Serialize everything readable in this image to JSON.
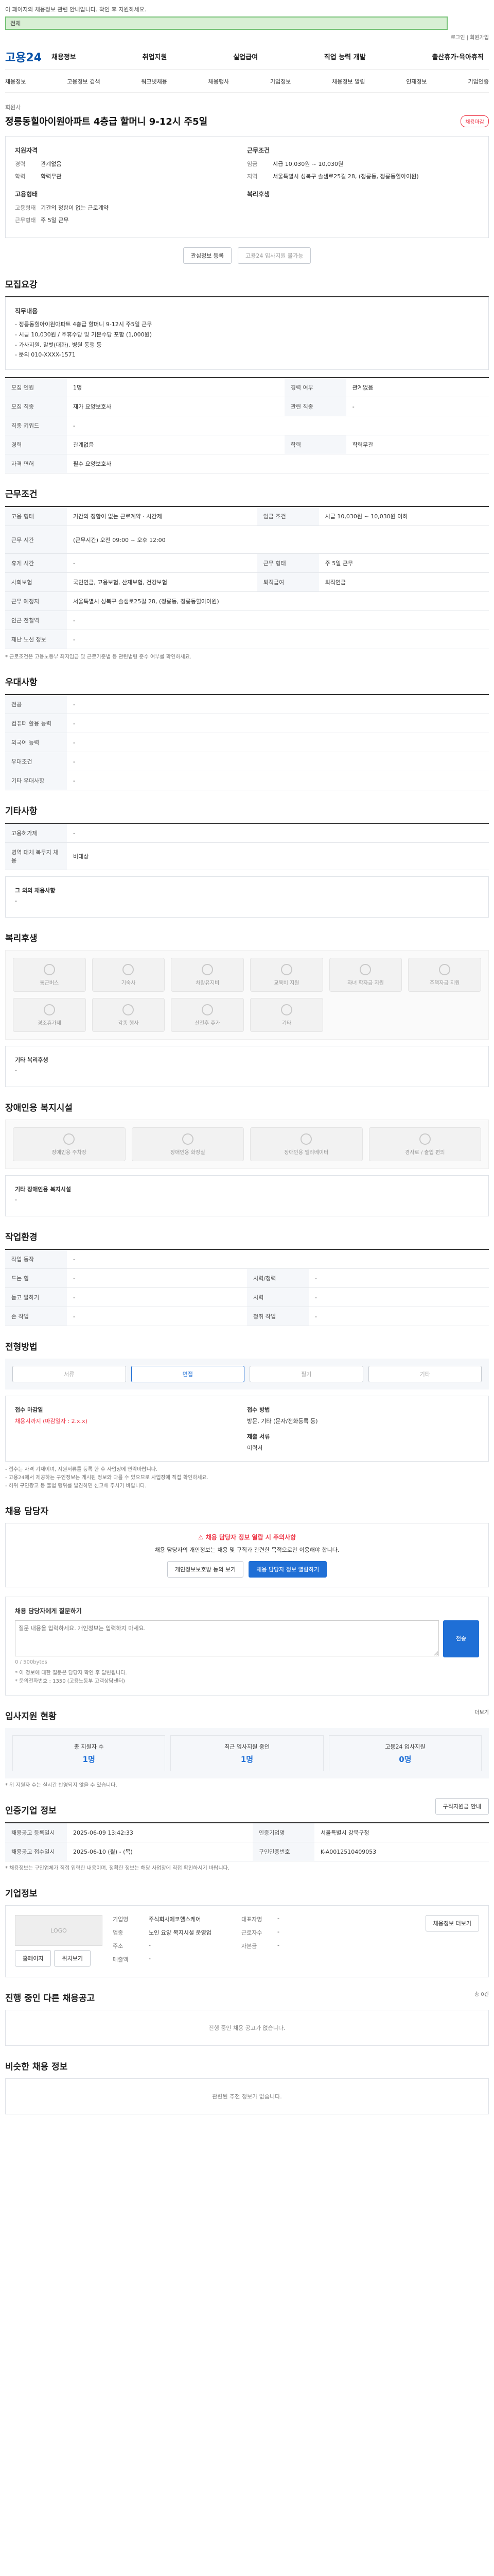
{
  "top_notice": "이 페이지의 채용정보 관련 안내입니다. 확인 후 지원하세요.",
  "search": {
    "scope_label": "전체",
    "value": ""
  },
  "utility_links": "로그인 | 회원가입",
  "gnb": {
    "logo": "고용24",
    "menu": [
      "채용정보",
      "취업지원",
      "실업급여",
      "직업 능력 개발",
      "출산휴가·육아휴직"
    ]
  },
  "subnav": [
    "채용정보",
    "고용정보 검색",
    "워크넷채용",
    "채용행사",
    "기업정보",
    "채용정보 알림",
    "인재정보",
    "기업인증"
  ],
  "job": {
    "company_label": "회원사",
    "title": "정릉동힐아이원아파트 4층급 할머니 9-12시 주5일",
    "badge": "채용마감",
    "left_col_title": "지원자격",
    "left_rows": [
      {
        "k": "경력",
        "v": "관계없음"
      },
      {
        "k": "학력",
        "v": "학력무관"
      }
    ],
    "right_col_title": "근무조건",
    "right_rows": [
      {
        "k": "임금",
        "v": "시급 10,030원 ~ 10,030원"
      },
      {
        "k": "지역",
        "v": "서울특별시 성북구 솔샘로25길 28, (정릉동, 정릉동힐아이원)"
      }
    ],
    "left2_title": "고용형태",
    "left2_rows": [
      {
        "k": "고용형태",
        "v": "기간의 정함이 없는 근로계약"
      },
      {
        "k": "근무형태",
        "v": "주 5일 근무"
      }
    ],
    "right2_title": "복리후생",
    "btn_interest": "관심정보 등록",
    "btn_apply": "고용24 입사지원 불가능"
  },
  "recruit": {
    "title": "모집요강",
    "duty_label": "직무내용",
    "duty_lines": [
      "- 정릉동힐아이원아파트 4층급 할머니 9-12시 주5일 근무",
      "- 시급 10,030원 / 주휴수당 및 기본수당 포함 (1,000원)",
      "- 가사지원, 말벗(대화), 병원 동행 등",
      "- 문의 010-XXXX-1571"
    ],
    "rows": [
      [
        "모집 인원",
        "1명",
        "경력 여부",
        "관계없음"
      ],
      [
        "모집 직종",
        "재가 요양보호사",
        "관련 직종",
        "-"
      ],
      [
        "직종 키워드",
        "-",
        "",
        ""
      ],
      [
        "경력",
        "관계없음",
        "학력",
        "학력무관"
      ],
      [
        "자격 면허",
        "필수 요양보호사",
        "",
        ""
      ]
    ]
  },
  "work": {
    "title": "근무조건",
    "rows": [
      [
        "고용 형태",
        "기간의 정함이 없는 근로계약 · 시간제",
        "임금 조건",
        "시급 10,030원 ~ 10,030원 이하"
      ],
      [
        "근무 시간",
        "(근무시간) 오전 09:00 ~ 오후 12:00",
        "",
        ""
      ],
      [
        "휴게 시간",
        "-",
        "근무 형태",
        "주 5일 근무"
      ],
      [
        "사회보험",
        "국민연금, 고용보험, 산재보험, 건강보험",
        "퇴직급여",
        "퇴직연금"
      ],
      [
        "근무 예정지",
        "서울특별시 성북구 솔샘로25길 28, (정릉동, 정릉동힐아이원)",
        "",
        ""
      ],
      [
        "인근 전철역",
        "-",
        "",
        ""
      ],
      [
        "재난 노선 정보",
        "-",
        "",
        ""
      ]
    ],
    "note": "* 근로조건은 고용노동부 최저임금 및 근로기준법 등 관련법령 준수 여부를 확인하세요."
  },
  "pref": {
    "title": "우대사항",
    "rows": [
      [
        "전공",
        "-"
      ],
      [
        "컴퓨터 활용 능력",
        "-"
      ],
      [
        "외국어 능력",
        "-"
      ],
      [
        "우대조건",
        "-"
      ],
      [
        "기타 우대사항",
        "-"
      ]
    ]
  },
  "etc": {
    "title": "기타사항",
    "rows": [
      [
        "고용허가제",
        "-"
      ],
      [
        "병역 대체 복무지 채용",
        "비대상"
      ]
    ],
    "etc_label": "그 외의 채용사항",
    "etc_value": "-"
  },
  "welfare": {
    "title": "복리후생",
    "items": [
      "통근버스",
      "기숙사",
      "차량유지비",
      "교육비 지원",
      "자녀 학자금 지원",
      "주택자금 지원",
      "경조휴가제",
      "각종 행사",
      "산전후 휴가",
      "기타"
    ],
    "etc_label": "기타 복리후생",
    "etc_value": "-"
  },
  "disabled": {
    "title": "장애인용 복지시설",
    "items": [
      "장애인용 주차장",
      "장애인용 화장실",
      "장애인용 엘리베이터",
      "경사로 / 출입 편의"
    ],
    "etc_label": "기타 장애인용 복지시설",
    "etc_value": "-"
  },
  "env": {
    "title": "작업환경",
    "rows": [
      [
        "작업 동작",
        "-",
        "",
        ""
      ],
      [
        "드는 힘",
        "-",
        "시력/청력",
        "-"
      ],
      [
        "듣고 말하기",
        "-",
        "시력",
        "-"
      ],
      [
        "손 작업",
        "-",
        "청취 작업",
        "-"
      ]
    ]
  },
  "method": {
    "title": "전형방법",
    "steps": [
      "서류",
      "면접",
      "필기",
      "기타"
    ],
    "deadline_label": "접수 마감일",
    "deadline_value": "채용시까지 (마감일자 : 2.x.x)",
    "method_label": "접수 방법",
    "method_value": "방문, 기타 (문자/전화등록 등)",
    "docs_label": "제출 서류",
    "docs_value": "이력서",
    "notes": [
      "- 접수는 자격 기재이며, 지원서류를 등록 한 후 사업장에 연락바랍니다.",
      "- 고용24에서 제공하는 구인정보는 게시된 정보와 다를 수 있으므로 사업장에 직접 확인하세요.",
      "- 허위 구인광고 등 불법 행위를 발견하면 신고해 주시기 바랍니다."
    ]
  },
  "manager": {
    "title": "채용 담당자",
    "alert_title": "채용 담당자 정보 열람 시 주의사항",
    "alert_text": "채용 담당자의 개인정보는 채용 및 구직과 관련한 목적으로만 이용해야 합니다.",
    "btn_call": "개인정보보호방 동의 보기",
    "btn_view": "채용 담당자 정보 열람하기"
  },
  "inquiry": {
    "title": "채용 담당자에게 질문하기",
    "placeholder": "질문 내용을 입력하세요. 개인정보는 입력하지 마세요.",
    "counter": "0 / 500bytes",
    "btn": "전송",
    "notes": [
      "* 이 정보에 대한 질문은 담당자 확인 후 답변됩니다.",
      "* 문의전화번호 : 1350 (고용노동부 고객상담센터)"
    ]
  },
  "stats": {
    "title": "입사지원 현황",
    "link": "더보기",
    "items": [
      {
        "label": "총 지원자 수",
        "value": "1명"
      },
      {
        "label": "최근 입사지원 중인",
        "value": "1명"
      },
      {
        "label": "고용24 입사지원",
        "value": "0명"
      }
    ],
    "note": "* 위 지원자 수는 실시간 반영되지 않을 수 있습니다."
  },
  "info": {
    "title": "인증기업 정보",
    "link": "구직지원금 안내",
    "rows": [
      [
        "채용공고 등록일시",
        "2025-06-09 13:42:33",
        "인증기업명",
        "서울특별시 강북구청"
      ],
      [
        "채용공고 접수일시",
        "2025-06-10 (월) - (목)",
        "구인인증번호",
        "K-A0012510409053"
      ]
    ],
    "note": "* 채용정보는 구인업체가 직접 입력한 내용이며, 정확한 정보는 해당 사업장에 직접 확인하시기 바랍니다."
  },
  "company": {
    "title": "기업정보",
    "logo_label": "LOGO",
    "btn_home": "홈페이지",
    "btn_map": "위치보기",
    "rows": [
      [
        "기업명",
        "주식회사에코헬스케어",
        "대표자명",
        "-"
      ],
      [
        "업종",
        "노인 요양 복지시설 운영업",
        "근로자수",
        "-"
      ],
      [
        "주소",
        "-",
        "자본금",
        "-"
      ],
      [
        "매출액",
        "-",
        "",
        ""
      ]
    ],
    "btn_detail": "채용정보 더보기"
  },
  "other_jobs": {
    "title": "진행 중인 다른 채용공고",
    "sub": "총 0건",
    "empty": "진행 중인 채용 공고가 없습니다."
  },
  "similar": {
    "title": "비슷한 채용 정보",
    "empty": "관련된 추천 정보가 없습니다."
  }
}
